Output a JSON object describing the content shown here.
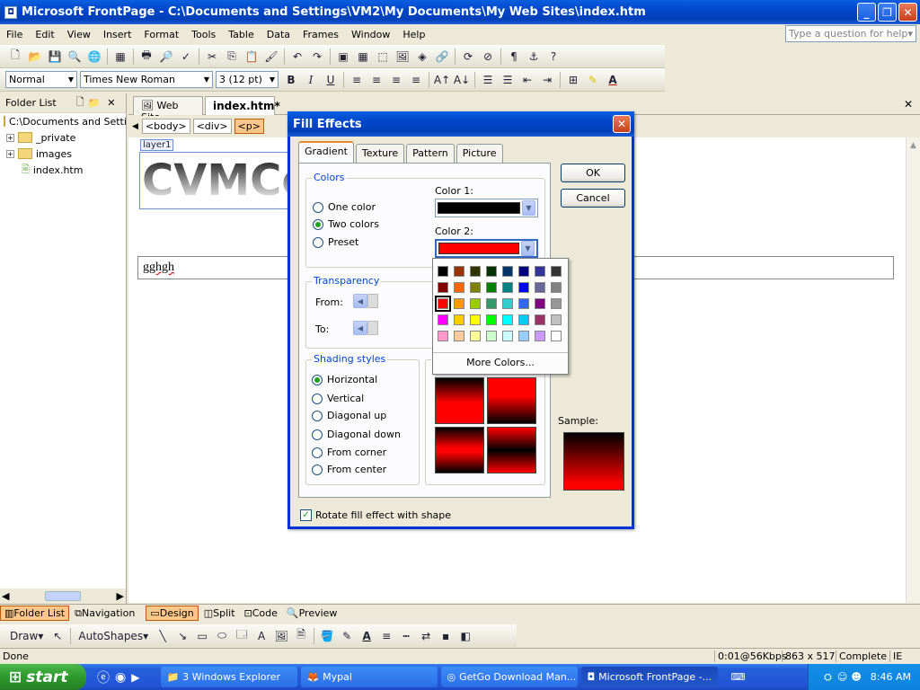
{
  "window": {
    "title": "Microsoft FrontPage - C:\\Documents and Settings\\VM2\\My Documents\\My Web Sites\\index.htm",
    "icon_letter": "◘"
  },
  "menu": [
    "File",
    "Edit",
    "View",
    "Insert",
    "Format",
    "Tools",
    "Table",
    "Data",
    "Frames",
    "Window",
    "Help"
  ],
  "ask_placeholder": "Type a question for help",
  "format": {
    "style": "Normal",
    "font": "Times New Roman",
    "size": "3 (12 pt)"
  },
  "folder_list": {
    "title": "Folder List",
    "root": "C:\\Documents and Setti",
    "items": [
      "_private",
      "images",
      "index.htm"
    ]
  },
  "doc_tabs": [
    "Web Site",
    "index.htm*"
  ],
  "breadcrumbs": [
    "<body>",
    "<div>",
    "<p>"
  ],
  "editor": {
    "layer_label": "layer1",
    "banner_text": "CVMCor",
    "typed_text": "gghgh"
  },
  "view_tabs": {
    "folder_list": "Folder List",
    "navigation": "Navigation",
    "design": "Design",
    "split": "Split",
    "code": "Code",
    "preview": "Preview"
  },
  "drawing": {
    "draw": "Draw",
    "autoshapes": "AutoShapes"
  },
  "status": {
    "left": "Done",
    "speed": "0:01@56Kbps",
    "size": "863 x 517",
    "complete": "Complete",
    "mode": "IE"
  },
  "taskbar": {
    "start": "start",
    "tasks": [
      "3 Windows Explorer",
      "Mypal",
      "GetGo Download Man...",
      "Microsoft FrontPage -..."
    ],
    "clock": "8:46 AM"
  },
  "dialog": {
    "title": "Fill Effects",
    "tabs": [
      "Gradient",
      "Texture",
      "Pattern",
      "Picture"
    ],
    "colors_legend": "Colors",
    "color_options": [
      "One color",
      "Two colors",
      "Preset"
    ],
    "color_selected": "Two colors",
    "color1_label": "Color 1:",
    "color2_label": "Color 2:",
    "color1_value": "#000000",
    "color2_value": "#ff0000",
    "transparency_legend": "Transparency",
    "from_label": "From:",
    "to_label": "To:",
    "shading_legend": "Shading styles",
    "shading_options": [
      "Horizontal",
      "Vertical",
      "Diagonal up",
      "Diagonal down",
      "From corner",
      "From center"
    ],
    "shading_selected": "Horizontal",
    "variants_legend": "V",
    "sample_label": "Sample:",
    "ok": "OK",
    "cancel": "Cancel",
    "rotate_label": "Rotate fill effect with shape",
    "rotate_checked": true
  },
  "palette": {
    "colors": [
      "#000000",
      "#993300",
      "#333300",
      "#003300",
      "#003366",
      "#000080",
      "#333399",
      "#333333",
      "#800000",
      "#ff6600",
      "#808000",
      "#008000",
      "#008080",
      "#0000ff",
      "#666699",
      "#808080",
      "#ff0000",
      "#ff9900",
      "#99cc00",
      "#339966",
      "#33cccc",
      "#3366ff",
      "#800080",
      "#969696",
      "#ff00ff",
      "#ffcc00",
      "#ffff00",
      "#00ff00",
      "#00ffff",
      "#00ccff",
      "#993366",
      "#c0c0c0",
      "#ff99cc",
      "#ffcc99",
      "#ffff99",
      "#ccffcc",
      "#ccffff",
      "#99ccff",
      "#cc99ff",
      "#ffffff"
    ],
    "selected_index": 16,
    "more": "More Colors..."
  }
}
